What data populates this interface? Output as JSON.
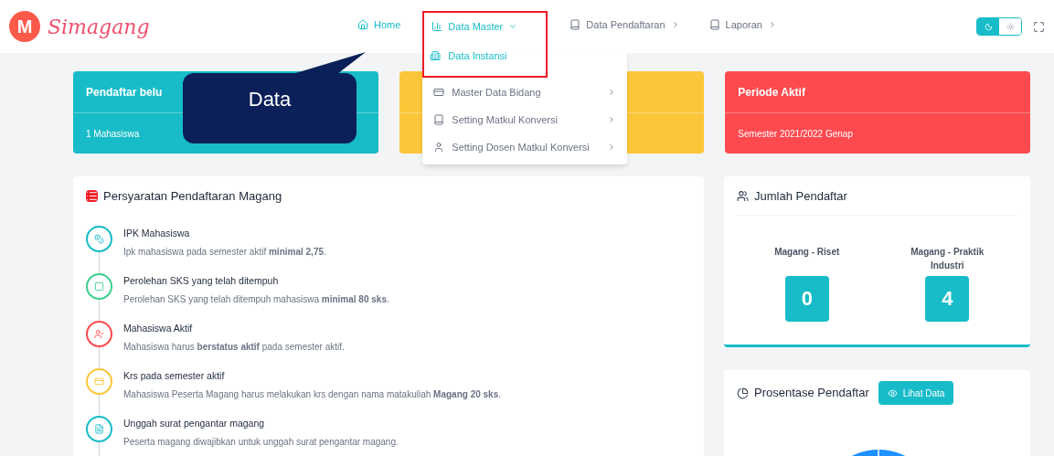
{
  "brand": {
    "logo_letter": "M",
    "name": "Simagang"
  },
  "nav": [
    {
      "label": "Home",
      "kind": "home",
      "annotated": false
    },
    {
      "label": "Data Master",
      "kind": "dropdown",
      "annotated": true
    },
    {
      "label": "Data Pendaftaran",
      "kind": "submenu",
      "annotated": false
    },
    {
      "label": "Laporan",
      "kind": "submenu",
      "annotated": false
    }
  ],
  "theme_toggle": [
    {
      "selected": true
    },
    {
      "selected": false
    }
  ],
  "dropdown": [
    {
      "label": "Data Instansi",
      "submenu": false,
      "selected": true
    },
    {
      "label": "Master Data Bidang",
      "submenu": true,
      "selected": false
    },
    {
      "label": "Setting Matkul Konversi",
      "submenu": true,
      "selected": false
    },
    {
      "label": "Setting Dosen Matkul Konversi",
      "submenu": true,
      "selected": false
    }
  ],
  "tooltip": {
    "text": "Data"
  },
  "stat_cards": [
    {
      "title": "Pendaftar belu",
      "value": "1 Mahasiswa",
      "color": "#17bcc8"
    },
    {
      "color": "#fcc63a"
    },
    {
      "title": "Periode Aktif",
      "value": "Semester 2021/2022 Genap",
      "color": "#fd4a4f"
    }
  ],
  "requirements": {
    "title": "Persyaratan Pendaftaran Magang",
    "items": [
      {
        "title": "IPK Mahasiswa",
        "text": "Ipk mahasiswa pada semester aktif **minimal 2,75**.",
        "color": "#17bcc8"
      },
      {
        "title": "Perolehan SKS yang telah ditempuh",
        "text": "Perolehan SKS yang telah ditempuh mahasiswa **minimal 80 sks**.",
        "color": "#3ecf8e"
      },
      {
        "title": "Mahasiswa Aktif",
        "text": "Mahasiswa harus **berstatus aktif** pada semester aktif.",
        "color": "#fd4a4f"
      },
      {
        "title": "Krs pada semester aktif",
        "text": "Mahasiswa Peserta Magang harus melakukan krs dengan nama matakuliah **Magang 20 sks**.",
        "color": "#fcc63a"
      },
      {
        "title": "Unggah surat pengantar magang",
        "text": "Peserta magang diwajibkan untuk unggah surat pengantar magang.",
        "color": "#17bcc8"
      }
    ]
  },
  "registrants": {
    "title": "Jumlah Pendaftar",
    "groups": [
      {
        "label": "Magang - Riset",
        "count": "0"
      },
      {
        "label": "Magang - Praktik Industri",
        "count": "4"
      }
    ]
  },
  "percentage": {
    "title": "Prosentase Pendaftar",
    "button": "Lihat Data"
  }
}
